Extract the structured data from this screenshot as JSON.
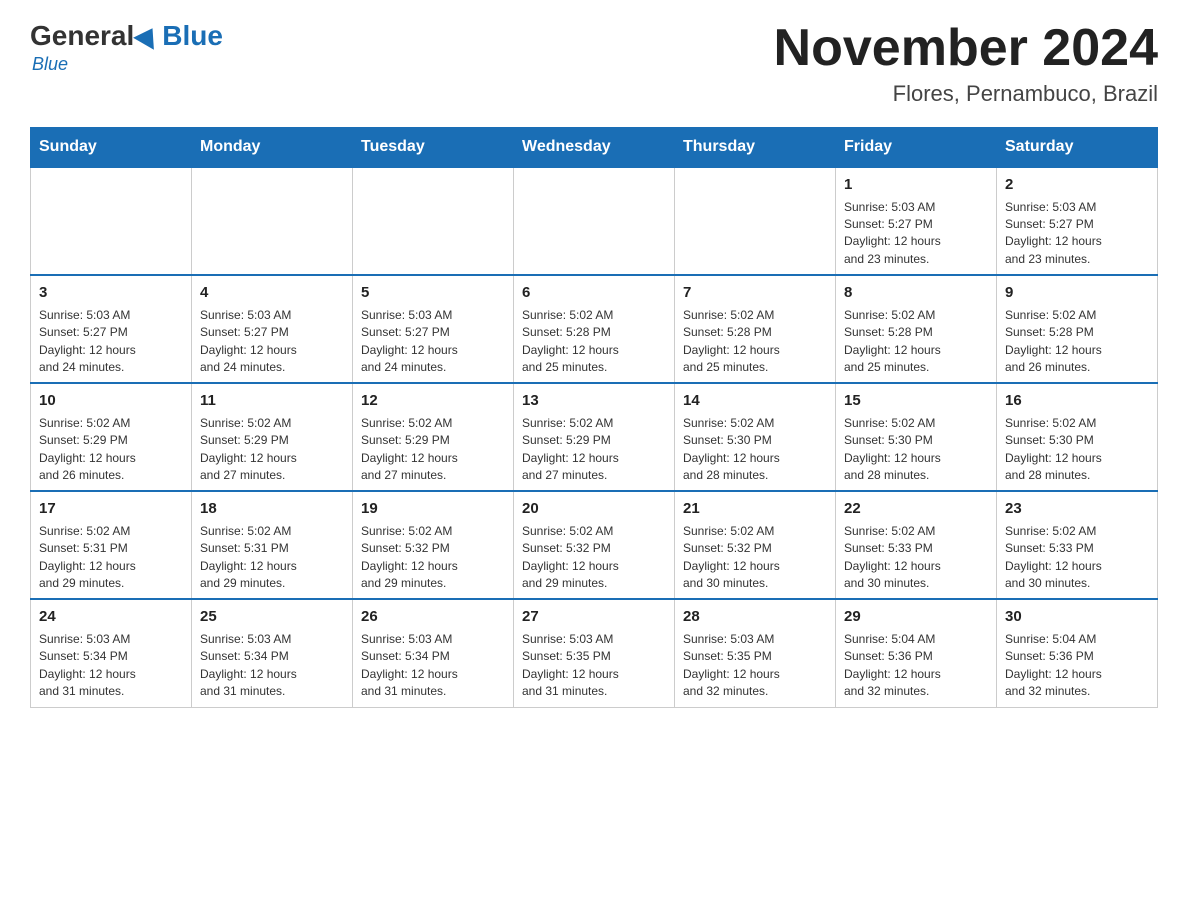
{
  "header": {
    "logo": {
      "general": "General",
      "blue": "Blue"
    },
    "title": "November 2024",
    "subtitle": "Flores, Pernambuco, Brazil"
  },
  "days_of_week": [
    "Sunday",
    "Monday",
    "Tuesday",
    "Wednesday",
    "Thursday",
    "Friday",
    "Saturday"
  ],
  "weeks": [
    [
      {
        "day": "",
        "info": ""
      },
      {
        "day": "",
        "info": ""
      },
      {
        "day": "",
        "info": ""
      },
      {
        "day": "",
        "info": ""
      },
      {
        "day": "",
        "info": ""
      },
      {
        "day": "1",
        "info": "Sunrise: 5:03 AM\nSunset: 5:27 PM\nDaylight: 12 hours\nand 23 minutes."
      },
      {
        "day": "2",
        "info": "Sunrise: 5:03 AM\nSunset: 5:27 PM\nDaylight: 12 hours\nand 23 minutes."
      }
    ],
    [
      {
        "day": "3",
        "info": "Sunrise: 5:03 AM\nSunset: 5:27 PM\nDaylight: 12 hours\nand 24 minutes."
      },
      {
        "day": "4",
        "info": "Sunrise: 5:03 AM\nSunset: 5:27 PM\nDaylight: 12 hours\nand 24 minutes."
      },
      {
        "day": "5",
        "info": "Sunrise: 5:03 AM\nSunset: 5:27 PM\nDaylight: 12 hours\nand 24 minutes."
      },
      {
        "day": "6",
        "info": "Sunrise: 5:02 AM\nSunset: 5:28 PM\nDaylight: 12 hours\nand 25 minutes."
      },
      {
        "day": "7",
        "info": "Sunrise: 5:02 AM\nSunset: 5:28 PM\nDaylight: 12 hours\nand 25 minutes."
      },
      {
        "day": "8",
        "info": "Sunrise: 5:02 AM\nSunset: 5:28 PM\nDaylight: 12 hours\nand 25 minutes."
      },
      {
        "day": "9",
        "info": "Sunrise: 5:02 AM\nSunset: 5:28 PM\nDaylight: 12 hours\nand 26 minutes."
      }
    ],
    [
      {
        "day": "10",
        "info": "Sunrise: 5:02 AM\nSunset: 5:29 PM\nDaylight: 12 hours\nand 26 minutes."
      },
      {
        "day": "11",
        "info": "Sunrise: 5:02 AM\nSunset: 5:29 PM\nDaylight: 12 hours\nand 27 minutes."
      },
      {
        "day": "12",
        "info": "Sunrise: 5:02 AM\nSunset: 5:29 PM\nDaylight: 12 hours\nand 27 minutes."
      },
      {
        "day": "13",
        "info": "Sunrise: 5:02 AM\nSunset: 5:29 PM\nDaylight: 12 hours\nand 27 minutes."
      },
      {
        "day": "14",
        "info": "Sunrise: 5:02 AM\nSunset: 5:30 PM\nDaylight: 12 hours\nand 28 minutes."
      },
      {
        "day": "15",
        "info": "Sunrise: 5:02 AM\nSunset: 5:30 PM\nDaylight: 12 hours\nand 28 minutes."
      },
      {
        "day": "16",
        "info": "Sunrise: 5:02 AM\nSunset: 5:30 PM\nDaylight: 12 hours\nand 28 minutes."
      }
    ],
    [
      {
        "day": "17",
        "info": "Sunrise: 5:02 AM\nSunset: 5:31 PM\nDaylight: 12 hours\nand 29 minutes."
      },
      {
        "day": "18",
        "info": "Sunrise: 5:02 AM\nSunset: 5:31 PM\nDaylight: 12 hours\nand 29 minutes."
      },
      {
        "day": "19",
        "info": "Sunrise: 5:02 AM\nSunset: 5:32 PM\nDaylight: 12 hours\nand 29 minutes."
      },
      {
        "day": "20",
        "info": "Sunrise: 5:02 AM\nSunset: 5:32 PM\nDaylight: 12 hours\nand 29 minutes."
      },
      {
        "day": "21",
        "info": "Sunrise: 5:02 AM\nSunset: 5:32 PM\nDaylight: 12 hours\nand 30 minutes."
      },
      {
        "day": "22",
        "info": "Sunrise: 5:02 AM\nSunset: 5:33 PM\nDaylight: 12 hours\nand 30 minutes."
      },
      {
        "day": "23",
        "info": "Sunrise: 5:02 AM\nSunset: 5:33 PM\nDaylight: 12 hours\nand 30 minutes."
      }
    ],
    [
      {
        "day": "24",
        "info": "Sunrise: 5:03 AM\nSunset: 5:34 PM\nDaylight: 12 hours\nand 31 minutes."
      },
      {
        "day": "25",
        "info": "Sunrise: 5:03 AM\nSunset: 5:34 PM\nDaylight: 12 hours\nand 31 minutes."
      },
      {
        "day": "26",
        "info": "Sunrise: 5:03 AM\nSunset: 5:34 PM\nDaylight: 12 hours\nand 31 minutes."
      },
      {
        "day": "27",
        "info": "Sunrise: 5:03 AM\nSunset: 5:35 PM\nDaylight: 12 hours\nand 31 minutes."
      },
      {
        "day": "28",
        "info": "Sunrise: 5:03 AM\nSunset: 5:35 PM\nDaylight: 12 hours\nand 32 minutes."
      },
      {
        "day": "29",
        "info": "Sunrise: 5:04 AM\nSunset: 5:36 PM\nDaylight: 12 hours\nand 32 minutes."
      },
      {
        "day": "30",
        "info": "Sunrise: 5:04 AM\nSunset: 5:36 PM\nDaylight: 12 hours\nand 32 minutes."
      }
    ]
  ]
}
